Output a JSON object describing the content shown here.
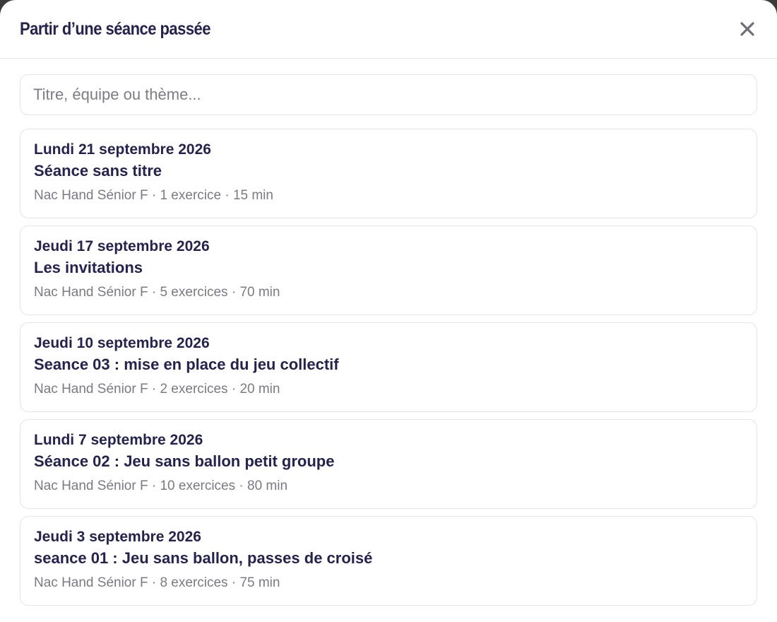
{
  "dialog": {
    "title": "Partir d’une séance passée",
    "close_icon": "close-icon"
  },
  "search": {
    "placeholder": "Titre, équipe ou thème...",
    "value": ""
  },
  "sessions": [
    {
      "date": "Lundi 21 septembre 2026",
      "title": "Séance sans titre",
      "meta": "Nac Hand Sénior F · 1 exercice · 15 min"
    },
    {
      "date": "Jeudi 17 septembre 2026",
      "title": "Les invitations",
      "meta": "Nac Hand Sénior F · 5 exercices · 70 min"
    },
    {
      "date": "Jeudi 10 septembre 2026",
      "title": "Seance 03 : mise en place du jeu collectif",
      "meta": "Nac Hand Sénior F · 2 exercices · 20 min"
    },
    {
      "date": "Lundi 7 septembre 2026",
      "title": "Séance 02 : Jeu sans ballon petit groupe",
      "meta": "Nac Hand Sénior F · 10 exercices · 80 min"
    },
    {
      "date": "Jeudi 3 septembre 2026",
      "title": "seance 01 : Jeu sans ballon, passes de croisé",
      "meta": "Nac Hand Sénior F · 8 exercices · 75 min"
    }
  ],
  "colors": {
    "text_primary": "#24224f",
    "text_secondary": "#7a7a84",
    "border": "#e4e4ea"
  }
}
